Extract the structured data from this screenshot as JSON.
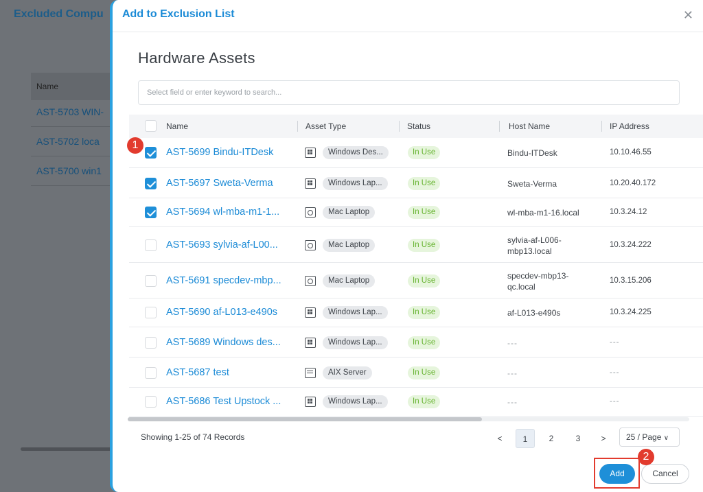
{
  "background": {
    "title": "Excluded Compu",
    "table_header": "Name",
    "rows": [
      "AST-5703 WIN-",
      "AST-5702 loca",
      "AST-5700 win1"
    ]
  },
  "modal": {
    "title": "Add to Exclusion List",
    "close_icon": "close-icon",
    "section_title": "Hardware Assets",
    "search_placeholder": "Select field or enter keyword to search...",
    "columns": {
      "name": "Name",
      "asset_type": "Asset Type",
      "status": "Status",
      "host_name": "Host Name",
      "ip_address": "IP Address"
    },
    "rows": [
      {
        "checked": true,
        "name": "AST-5699 Bindu-ITDesk",
        "icon": "windows-desktop-icon",
        "type": "Windows Des...",
        "status": "In Use",
        "host": "Bindu-ITDesk",
        "ip": "10.10.46.55"
      },
      {
        "checked": true,
        "name": "AST-5697 Sweta-Verma",
        "icon": "windows-laptop-icon",
        "type": "Windows Lap...",
        "status": "In Use",
        "host": "Sweta-Verma",
        "ip": "10.20.40.172"
      },
      {
        "checked": true,
        "name": "AST-5694 wl-mba-m1-1...",
        "icon": "mac-laptop-icon",
        "type": "Mac Laptop",
        "status": "In Use",
        "host": "wl-mba-m1-16.local",
        "ip": "10.3.24.12"
      },
      {
        "checked": false,
        "name": "AST-5693 sylvia-af-L00...",
        "icon": "mac-laptop-icon",
        "type": "Mac Laptop",
        "status": "In Use",
        "host": "sylvia-af-L006-\nmbp13.local",
        "ip": "10.3.24.222"
      },
      {
        "checked": false,
        "name": "AST-5691 specdev-mbp...",
        "icon": "mac-laptop-icon",
        "type": "Mac Laptop",
        "status": "In Use",
        "host": "specdev-mbp13-\nqc.local",
        "ip": "10.3.15.206"
      },
      {
        "checked": false,
        "name": "AST-5690 af-L013-e490s",
        "icon": "windows-laptop-icon",
        "type": "Windows Lap...",
        "status": "In Use",
        "host": "af-L013-e490s",
        "ip": "10.3.24.225"
      },
      {
        "checked": false,
        "name": "AST-5689 Windows des...",
        "icon": "windows-laptop-icon",
        "type": "Windows Lap...",
        "status": "In Use",
        "host": "---",
        "ip": "---"
      },
      {
        "checked": false,
        "name": "AST-5687 test",
        "icon": "aix-server-icon",
        "type": "AIX Server",
        "status": "In Use",
        "host": "---",
        "ip": "---"
      },
      {
        "checked": false,
        "name": "AST-5686 Test Upstock ...",
        "icon": "windows-laptop-icon",
        "type": "Windows Lap...",
        "status": "In Use",
        "host": "---",
        "ip": "---"
      }
    ],
    "records_text": "Showing 1-25 of 74 Records",
    "pager": {
      "prev": "<",
      "pages": [
        "1",
        "2",
        "3"
      ],
      "next": ">",
      "page_size": "25 / Page"
    },
    "add_label": "Add",
    "cancel_label": "Cancel",
    "markers": [
      "1",
      "2"
    ]
  },
  "colors": {
    "accent": "#1e8fd8",
    "status_green": "#65b32e",
    "marker_red": "#e23b2e"
  }
}
